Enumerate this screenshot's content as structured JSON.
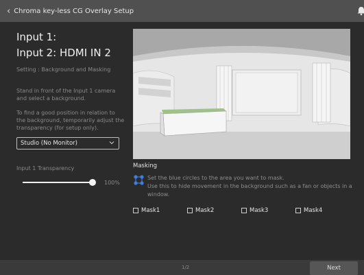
{
  "header": {
    "title": "Chroma key-less CG Overlay Setup",
    "back_icon": "chevron-left-icon",
    "bell_icon": "bell-icon"
  },
  "left": {
    "input1": "Input 1:",
    "input2": "Input 2: HDMI IN 2",
    "setting": "Setting : Background and Masking",
    "instr1_l1": "Stand in front of the Input 1 camera",
    "instr1_l2": "and select a background.",
    "instr2_l1": "To find a good position in relation to",
    "instr2_l2": "the background, temporarily adjust the",
    "instr2_l3": "transparency (for setup only).",
    "background_select": "Studio (No Monitor)",
    "transparency_label": "Input 1 Transparency",
    "transparency_value": "100%",
    "transparency_fraction": 1.0
  },
  "masking": {
    "label": "Masking",
    "line1": "Set the blue circles to the area you want to mask.",
    "line2": "Use this to hide movement in the background such as a fan or objects in a",
    "line3": "window.",
    "checkboxes": [
      {
        "label": "Mask1",
        "checked": false
      },
      {
        "label": "Mask2",
        "checked": false
      },
      {
        "label": "Mask3",
        "checked": false
      },
      {
        "label": "Mask4",
        "checked": false
      }
    ]
  },
  "footer": {
    "page": "1/2",
    "next": "Next"
  },
  "colors": {
    "topbar": "#505050",
    "body": "#2b2b2b",
    "mask_icon": "#3d7fe0"
  }
}
